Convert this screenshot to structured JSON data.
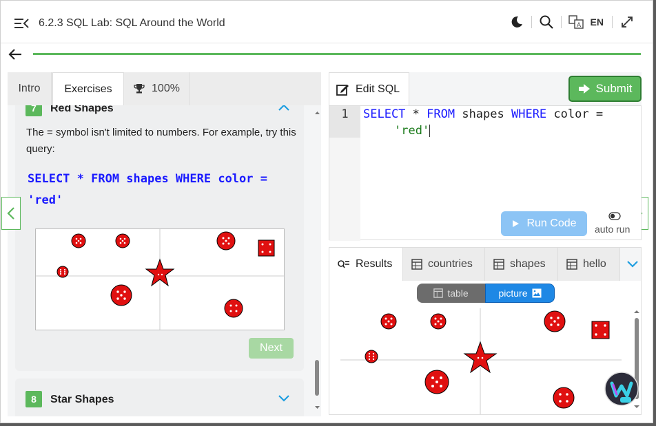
{
  "header": {
    "title": "6.2.3 SQL Lab: SQL Around the World",
    "language": "EN"
  },
  "left": {
    "tabs": [
      {
        "label": "Intro"
      },
      {
        "label": "Exercises"
      },
      {
        "label": "100%"
      }
    ],
    "exercise7": {
      "number": "7",
      "title": "Red Shapes",
      "description": "The = symbol isn't limited to numbers. For example, try this query:",
      "query_line1": "SELECT * FROM shapes WHERE color =",
      "query_line2": "'red'",
      "next_label": "Next"
    },
    "exercise8": {
      "number": "8",
      "title": "Star Shapes"
    }
  },
  "editor": {
    "tab_label": "Edit SQL",
    "submit_label": "Submit",
    "line_number": "1",
    "code_kw1": "SELECT",
    "code_op1": " * ",
    "code_kw2": "FROM",
    "code_t1": " shapes ",
    "code_kw3": "WHERE",
    "code_t2": " color =",
    "code_str": "'red'",
    "run_label": "Run Code",
    "autorun_label": "auto run"
  },
  "results": {
    "tabs": [
      {
        "label": "Results"
      },
      {
        "label": "countries"
      },
      {
        "label": "shapes"
      },
      {
        "label": "hello"
      }
    ],
    "view_table": "table",
    "view_picture": "picture"
  },
  "colors": {
    "green": "#5cb85c",
    "blue": "#1e88e5",
    "shape_red": "#ee1111"
  }
}
